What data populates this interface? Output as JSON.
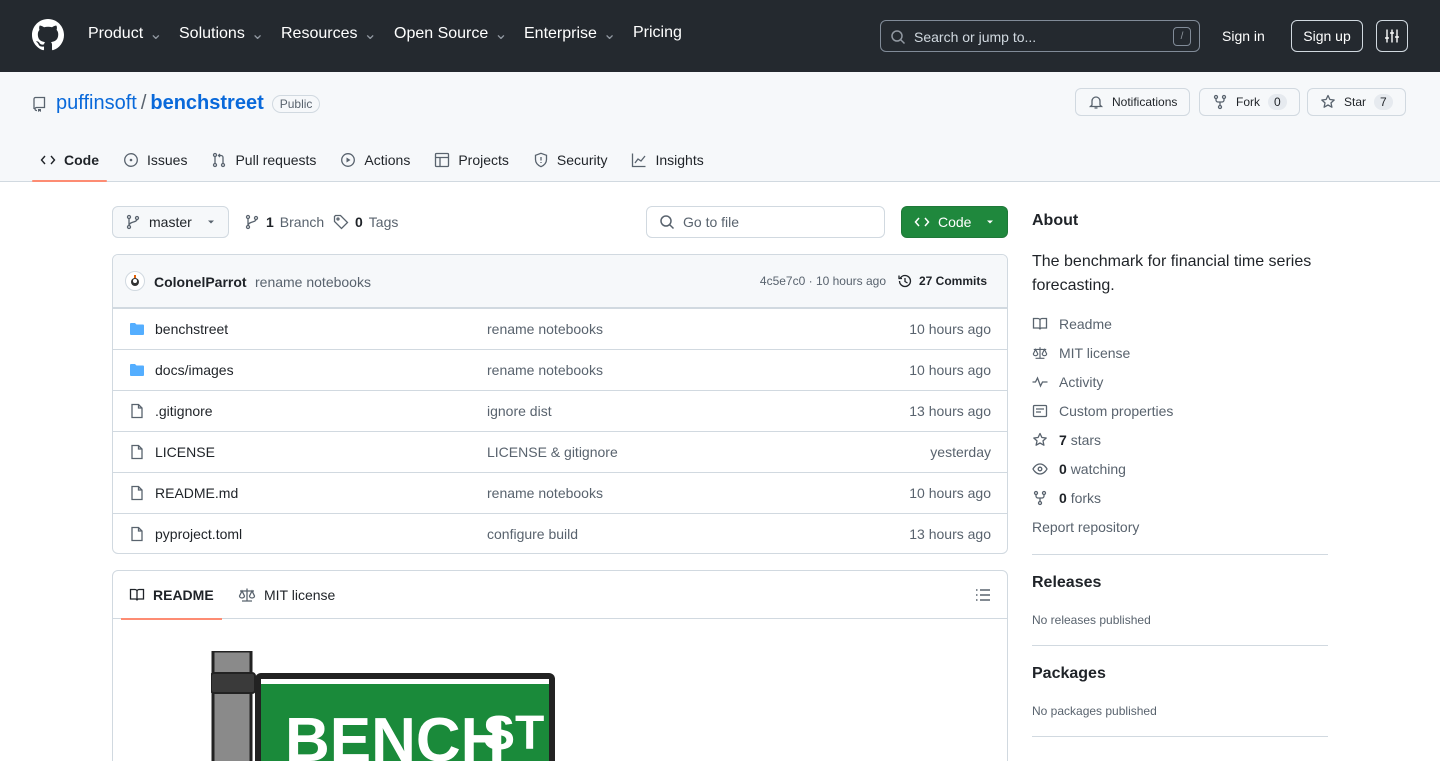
{
  "header": {
    "nav": [
      "Product",
      "Solutions",
      "Resources",
      "Open Source",
      "Enterprise",
      "Pricing"
    ],
    "search_placeholder": "Search or jump to...",
    "search_shortcut": "/",
    "sign_in": "Sign in",
    "sign_up": "Sign up"
  },
  "repo": {
    "owner": "puffinsoft",
    "separator": "/",
    "name": "benchstreet",
    "visibility": "Public",
    "notifications_label": "Notifications",
    "fork_label": "Fork",
    "fork_count": "0",
    "star_label": "Star",
    "star_count": "7"
  },
  "tabs": [
    "Code",
    "Issues",
    "Pull requests",
    "Actions",
    "Projects",
    "Security",
    "Insights"
  ],
  "toolbar": {
    "branch": "master",
    "branches_count": "1",
    "branches_label": "Branch",
    "tags_count": "0",
    "tags_label": "Tags",
    "goto_file": "Go to file",
    "code_button": "Code"
  },
  "latest_commit": {
    "author": "ColonelParrot",
    "message": "rename notebooks",
    "sha_time": "4c5e7c0 · 10 hours ago",
    "commits_label": "27 Commits"
  },
  "files": [
    {
      "name": "benchstreet",
      "type": "folder",
      "message": "rename notebooks",
      "date": "10 hours ago"
    },
    {
      "name": "docs/images",
      "type": "folder",
      "message": "rename notebooks",
      "date": "10 hours ago"
    },
    {
      "name": ".gitignore",
      "type": "file",
      "message": "ignore dist",
      "date": "13 hours ago"
    },
    {
      "name": "LICENSE",
      "type": "file",
      "message": "LICENSE & gitignore",
      "date": "yesterday"
    },
    {
      "name": "README.md",
      "type": "file",
      "message": "rename notebooks",
      "date": "10 hours ago"
    },
    {
      "name": "pyproject.toml",
      "type": "file",
      "message": "configure build",
      "date": "13 hours ago"
    }
  ],
  "readme": {
    "tab_readme": "README",
    "tab_license": "MIT license",
    "banner_text_1": "BENCH",
    "banner_text_2": "ST"
  },
  "about": {
    "title": "About",
    "description": "The benchmark for financial time series forecasting.",
    "readme": "Readme",
    "license": "MIT license",
    "activity": "Activity",
    "custom_properties": "Custom properties",
    "stars_count": "7",
    "stars_label": "stars",
    "watching_count": "0",
    "watching_label": "watching",
    "forks_count": "0",
    "forks_label": "forks",
    "report": "Report repository"
  },
  "releases": {
    "title": "Releases",
    "empty": "No releases published"
  },
  "packages": {
    "title": "Packages",
    "empty": "No packages published"
  },
  "colors": {
    "header_bg": "#24292f",
    "link": "#0969da",
    "primary_button": "#1f883d",
    "folder": "#54aeff",
    "active_tab": "#fd8c73"
  }
}
